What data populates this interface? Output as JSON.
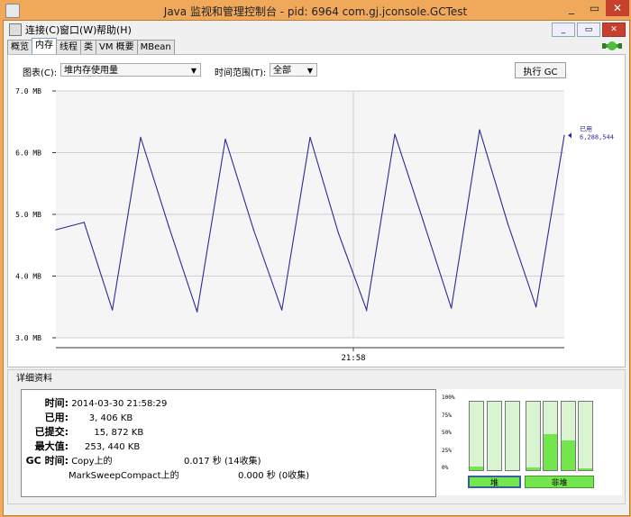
{
  "window": {
    "title": "Java 监视和管理控制台 - pid: 6964 com.gj.jconsole.GCTest",
    "min_glyph": "_",
    "max_glyph": "▭",
    "close_glyph": "✕"
  },
  "menu": {
    "items": [
      "连接(C)",
      "窗口(W)",
      "帮助(H)"
    ]
  },
  "mdi": {
    "min": "_",
    "restore": "▭",
    "close": "✕"
  },
  "tabs": [
    "概览",
    "内存",
    "线程",
    "类",
    "VM 概要",
    "MBean"
  ],
  "active_tab": 1,
  "controls": {
    "chart_label": "图表(C):",
    "chart_value": "堆内存使用量",
    "range_label": "时间范围(T):",
    "range_value": "全部",
    "gc_button": "执行 GC"
  },
  "chart_data": {
    "type": "line",
    "y_unit_ticks": [
      "7.0 MB",
      "6.0 MB",
      "5.0 MB",
      "4.0 MB",
      "3.0 MB"
    ],
    "ylim": [
      3.0,
      7.0
    ],
    "x_tick_label": "21:58",
    "series": [
      {
        "name": "已用",
        "color": "#2a2a9a",
        "values": [
          4.75,
          4.87,
          3.45,
          6.25,
          4.8,
          3.42,
          6.22,
          4.75,
          3.45,
          6.25,
          4.7,
          3.45,
          6.3,
          4.9,
          3.48,
          6.37,
          4.85,
          3.5,
          6.28
        ]
      }
    ],
    "legend_label": "已用",
    "legend_value": "6,288,544"
  },
  "details": {
    "title": "详细资料",
    "time_label": "时间:",
    "time_value": "2014-03-30 21:58:29",
    "used_label": "已用:",
    "used_value": "3, 406 KB",
    "committed_label": "已提交:",
    "committed_value": "15, 872 KB",
    "max_label": "最大值:",
    "max_value": "253, 440 KB",
    "gc_label": "GC 时间:",
    "gc_rows": [
      {
        "name": "Copy上的",
        "value": "0.017 秒 (14收集)"
      },
      {
        "name": "MarkSweepCompact上的",
        "value": "0.000 秒 (0收集)"
      }
    ]
  },
  "pools": {
    "y_labels": [
      "100%",
      "75%",
      "50%",
      "25%",
      "0%"
    ],
    "heap_label": "堆",
    "nonheap_label": "非堆",
    "heap_fill": [
      0.05,
      0.0,
      0.0
    ],
    "nonheap_fill": [
      0.04,
      0.52,
      0.43,
      0.03
    ],
    "bar_fill_color": "#73e64d"
  }
}
